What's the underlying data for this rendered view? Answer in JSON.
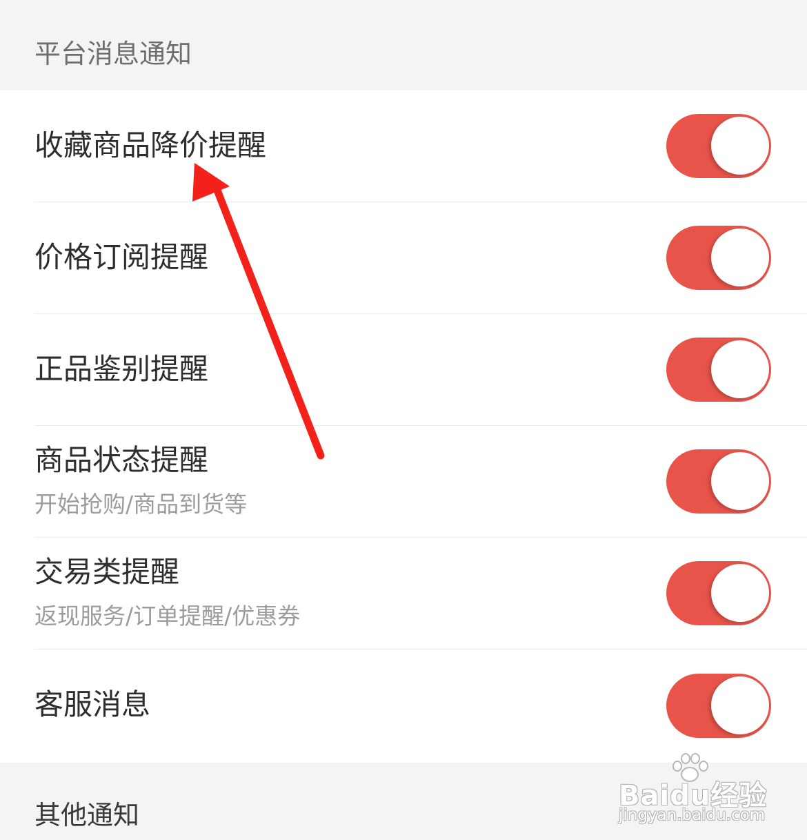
{
  "sections": {
    "platform": {
      "title": "平台消息通知"
    },
    "other": {
      "title": "其他通知"
    }
  },
  "settings": [
    {
      "label": "收藏商品降价提醒",
      "subtitle": "",
      "enabled": true
    },
    {
      "label": "价格订阅提醒",
      "subtitle": "",
      "enabled": true
    },
    {
      "label": "正品鉴别提醒",
      "subtitle": "",
      "enabled": true
    },
    {
      "label": "商品状态提醒",
      "subtitle": "开始抢购/商品到货等",
      "enabled": true
    },
    {
      "label": "交易类提醒",
      "subtitle": "返现服务/订单提醒/优惠券",
      "enabled": true
    },
    {
      "label": "客服消息",
      "subtitle": "",
      "enabled": true
    }
  ],
  "colors": {
    "toggle_on": "#e8544a",
    "annotation_arrow": "#f2221b",
    "section_bg": "#f4f4f5"
  },
  "annotation": {
    "icon": "red-arrow-icon"
  },
  "watermark": {
    "brand": "Baidu经验",
    "url": "jingyan.baidu.com",
    "icon": "paw-icon"
  }
}
